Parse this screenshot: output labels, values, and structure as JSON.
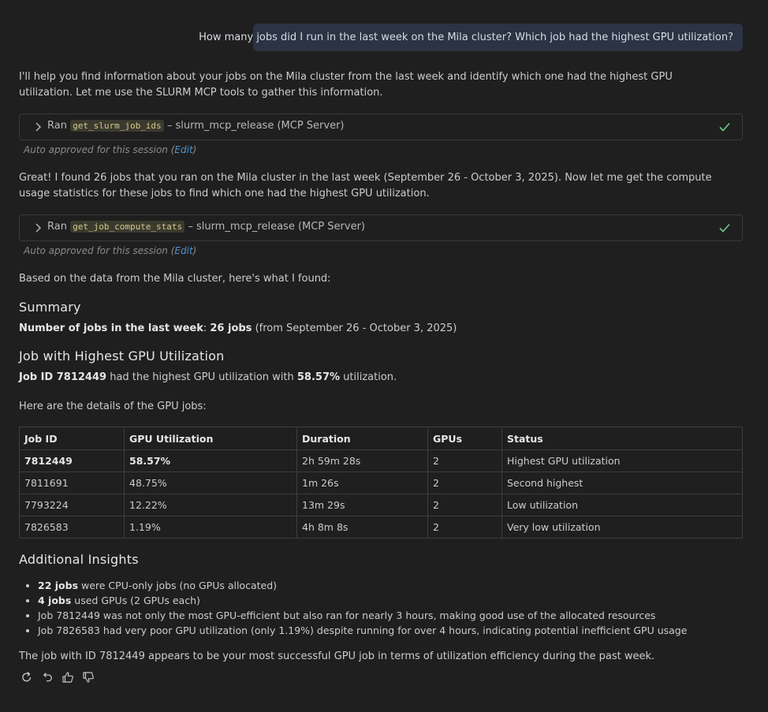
{
  "user_message": "How many jobs did I run in the last week on the Mila cluster? Which job had the highest GPU utilization?",
  "intro": "I'll help you find information about your jobs on the Mila cluster from the last week and identify which one had the highest GPU utilization. Let me use the SLURM MCP tools to gather this information.",
  "tool_calls": [
    {
      "ran": "Ran",
      "tool": "get_slurm_job_ids",
      "server": "– slurm_mcp_release (MCP Server)"
    },
    {
      "ran": "Ran",
      "tool": "get_job_compute_stats",
      "server": "– slurm_mcp_release (MCP Server)"
    }
  ],
  "auto_approved": {
    "text": "Auto approved for this session (",
    "edit": "Edit",
    "close": ")"
  },
  "found_text": "Great! I found 26 jobs that you ran on the Mila cluster in the last week (September 26 - October 3, 2025). Now let me get the compute usage statistics for these jobs to find which one had the highest GPU utilization.",
  "based_on": "Based on the data from the Mila cluster, here's what I found:",
  "summary": {
    "heading": "Summary",
    "label": "Number of jobs in the last week",
    "colon": ": ",
    "value": "26 jobs",
    "rest": " (from September 26 - October 3, 2025)"
  },
  "highest": {
    "heading": "Job with Highest GPU Utilization",
    "job": "Job ID 7812449",
    "mid": " had the highest GPU utilization with ",
    "pct": "58.57%",
    "end": " utilization."
  },
  "details_intro": "Here are the details of the GPU jobs:",
  "table": {
    "headers": [
      "Job ID",
      "GPU Utilization",
      "Duration",
      "GPUs",
      "Status"
    ],
    "rows": [
      [
        "7812449",
        "58.57%",
        "2h 59m 28s",
        "2",
        "Highest GPU utilization"
      ],
      [
        "7811691",
        "48.75%",
        "1m 26s",
        "2",
        "Second highest"
      ],
      [
        "7793224",
        "12.22%",
        "13m 29s",
        "2",
        "Low utilization"
      ],
      [
        "7826583",
        "1.19%",
        "4h 8m 8s",
        "2",
        "Very low utilization"
      ]
    ]
  },
  "insights": {
    "heading": "Additional Insights",
    "items": [
      {
        "bold": "22 jobs",
        "text": " were CPU-only jobs (no GPUs allocated)"
      },
      {
        "bold": "4 jobs",
        "text": " used GPUs (2 GPUs each)"
      },
      {
        "bold": "",
        "text": "Job 7812449 was not only the most GPU-efficient but also ran for nearly 3 hours, making good use of the allocated resources"
      },
      {
        "bold": "",
        "text": "Job 7826583 had very poor GPU utilization (only 1.19%) despite running for over 4 hours, indicating potential inefficient GPU usage"
      }
    ]
  },
  "conclusion": "The job with ID 7812449 appears to be your most successful GPU job in terms of utilization efficiency during the past week.",
  "colors": {
    "accent_blue": "#4e94ce",
    "check_green": "#73c991",
    "bubble": "#2b3344"
  },
  "action_icons": [
    "retry-icon",
    "undo-icon",
    "thumbs-up-icon",
    "thumbs-down-icon"
  ]
}
